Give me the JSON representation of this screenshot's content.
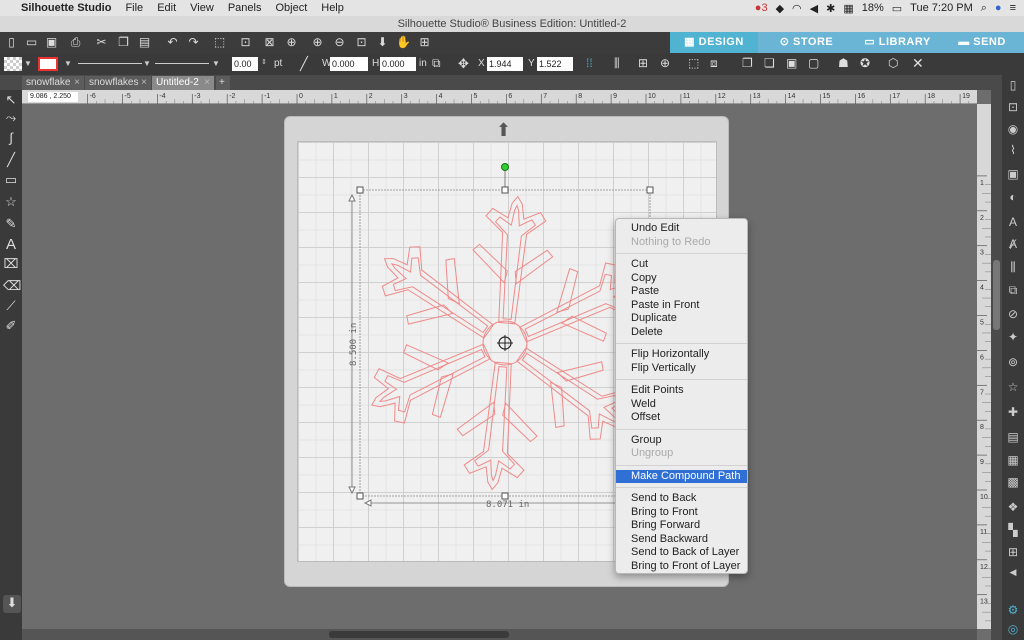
{
  "menubar": {
    "app": "Silhouette Studio",
    "items": [
      "File",
      "Edit",
      "View",
      "Panels",
      "Object",
      "Help"
    ],
    "battery": "18%",
    "clock": "Tue 7:20 PM",
    "notif_count": "3"
  },
  "window": {
    "title": "Silhouette Studio® Business Edition: Untitled-2"
  },
  "nav": {
    "design": "DESIGN",
    "store": "STORE",
    "library": "LIBRARY",
    "send": "SEND"
  },
  "toolbar": {
    "line_width": "0.00",
    "line_unit": "pt",
    "w_label": "W",
    "w_value": "0.000",
    "h_label": "H",
    "h_value": "0.000",
    "size_unit": "in",
    "x_label": "X",
    "x_value": "1.944",
    "y_label": "Y",
    "y_value": "1.522"
  },
  "tabs": [
    {
      "label": "snowflake"
    },
    {
      "label": "snowflakes"
    },
    {
      "label": "Untitled-2"
    }
  ],
  "ruler": {
    "coords": "9.086 , 2.250",
    "h_labels": [
      "-6",
      "-5",
      "-4",
      "-3",
      "-2",
      "-1",
      "0",
      "1",
      "2",
      "3",
      "4",
      "5",
      "6",
      "7",
      "8",
      "9",
      "10",
      "11",
      "12",
      "13",
      "14",
      "15",
      "16",
      "17",
      "18",
      "19"
    ],
    "v_labels": [
      "1",
      "2",
      "3",
      "4",
      "5",
      "6",
      "7",
      "8",
      "9",
      "10",
      "11",
      "12",
      "13",
      "14"
    ]
  },
  "dimensions": {
    "height": "8.500 in",
    "width": "8.071 in"
  },
  "context_menu": [
    {
      "label": "Undo Edit",
      "disabled": false
    },
    {
      "label": "Nothing to Redo",
      "disabled": true
    },
    {
      "sep": true
    },
    {
      "label": "Cut",
      "disabled": false
    },
    {
      "label": "Copy",
      "disabled": false
    },
    {
      "label": "Paste",
      "disabled": false
    },
    {
      "label": "Paste in Front",
      "disabled": false
    },
    {
      "label": "Duplicate",
      "disabled": false
    },
    {
      "label": "Delete",
      "disabled": false
    },
    {
      "sep": true
    },
    {
      "label": "Flip Horizontally",
      "disabled": false
    },
    {
      "label": "Flip Vertically",
      "disabled": false
    },
    {
      "sep": true
    },
    {
      "label": "Edit Points",
      "disabled": false
    },
    {
      "label": "Weld",
      "disabled": false
    },
    {
      "label": "Offset",
      "disabled": false
    },
    {
      "sep": true
    },
    {
      "label": "Group",
      "disabled": false
    },
    {
      "label": "Ungroup",
      "disabled": true
    },
    {
      "sep": true
    },
    {
      "label": "Make Compound Path",
      "disabled": false,
      "highlighted": true
    },
    {
      "sep": true
    },
    {
      "label": "Send to Back",
      "disabled": false
    },
    {
      "label": "Bring to Front",
      "disabled": false
    },
    {
      "label": "Bring Forward",
      "disabled": false
    },
    {
      "label": "Send Backward",
      "disabled": false
    },
    {
      "label": "Send to Back of Layer",
      "disabled": false
    },
    {
      "label": "Bring to Front of Layer",
      "disabled": false
    }
  ],
  "colors": {
    "accent": "#4fb3d1",
    "highlight": "#2f6fd6",
    "cut_line": "#f08a8a"
  }
}
